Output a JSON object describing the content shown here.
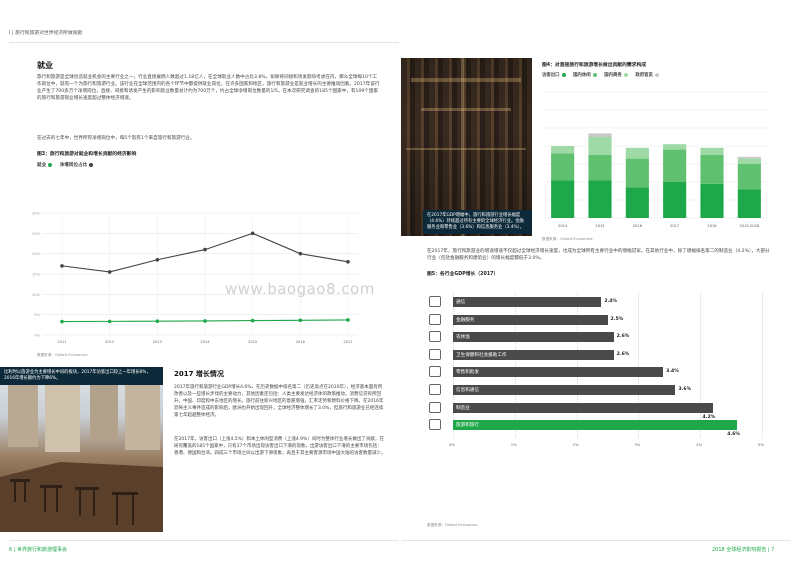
{
  "header": {
    "section_title": "I | 旅行和旅游对世界经济所做贡献"
  },
  "employment": {
    "heading": "就业",
    "paragraph1": "旅行和旅游是全球创造就业机会的主要行业之一，行业直接雇佣人数超过1.18亿人，在全球就业人数中占比3.8%。如果将间接和诱发影响考虑在内，那么全球每10个工作岗位中，就有一个为旅行和旅游行业。该行业在全球范围内的各个环节中都提供就业岗位，在许多国家和地区，旅行和旅游业是就业增长的主要推动因素。2017年该行业产生了700多万个净增岗位，直接、间接和诱发产生的影响就业数量总计约为700万个，约占全球净增岗位数量的1/5。在本次研究调查的185个国家中，有109个国家的旅行和旅游就业增长速度超过整体经济增速。",
    "paragraph2": "在过去的七年中，世界所有净增岗位中，每5个就有1个来自旅行和旅游行业。"
  },
  "figure3": {
    "title": "图3：旅行和旅游对就业和增长贡献的经济影响",
    "legend": [
      {
        "label": "就业",
        "color": "#1fa84a"
      },
      {
        "label": "净增岗位占比",
        "color": "#444444"
      }
    ],
    "source": "数据来源：Oxford Economics"
  },
  "growth2017": {
    "heading": "2017 增长情况",
    "paragraph1": "2017年旅行和旅游行业GDP增长4.6%，在历史数据中排名第二（历史高点在2010年），经济基本面有所改善以及一些增长步伐的主要动力，其他因素还包括：人类主要发达经济体的政策推动，消费信贷有所回升，中国、印度和中东地区的增长，旅行前往新兴地区的意愿增强，汇率走势和燃料价格下降。在2016年恐怖主义事件造成的影响后，欧洲也开始出现回升，全球经济整体增长了3.0%，但旅行和旅游业已经连续第七年超越整体经济。",
    "paragraph2": "在2017年，访客出口（上涨4.5%）和本土休闲型消费（上涨4.9%）同时为整体行业增长做出了贡献，在研究覆盖的185个国家中，只有37个市场出现访客出口下滑的现象。出游访客出口下滑的主要市场包括：香港、德国和台湾。四成三个市场之间以出游下滑现象，再且于其主要客源市场中国大陆的访客数量减少。"
  },
  "photo_top_caption": "在2017年GDP增幅中，旅行和旅游行业增长幅度（4.6%）持续超过所有主要的全球经济行业。金融服务业和零售业（3.6%）和信息服务业（3.4%）。",
  "photo_bottom_caption": "比利时以旅游业为主要增长中间的板块，2017年访客出口较上一年增长8%，2016年增长额约为下降6%。",
  "figure4": {
    "title": "图4：对直接旅行和旅游增长做出贡献的需求构成",
    "legend": [
      {
        "label": "访客出口",
        "color": "#1fa84a"
      },
      {
        "label": "国内休闲",
        "color": "#5fc16f"
      },
      {
        "label": "国内商务",
        "color": "#9ed9a6"
      },
      {
        "label": "政府官员",
        "color": "#c9c9c9"
      }
    ],
    "source": "数据来源：Oxford Economics"
  },
  "middle_paragraph": "在2017年，旅行和旅游业的增速增速不仅超过全球经济增长速度，也成为全球所有主要行业中的增幅冠军。在其他行业中，除了增幅排名第二的制造业（4.2%），大部分行业（包括金融服务和建筑业）的增长幅度都低于3.0%。",
  "figure5": {
    "title": "图5：各行业GDP增长（2017）",
    "source": "数据来源：Oxford Economics",
    "ticks": [
      "0%",
      "1%",
      "2%",
      "3%",
      "4%",
      "5%"
    ]
  },
  "footer": {
    "left": "6 | 世界旅行和旅游理事会",
    "right": "2018 全球经济影响报告 | 7"
  },
  "watermark": "www.baogao8.com",
  "chart_data": [
    {
      "type": "line",
      "x": [
        "2011",
        "2012",
        "2013",
        "2014",
        "2015",
        "2016",
        "2017"
      ],
      "series": [
        {
          "name": "就业",
          "values": [
            3.3,
            3.35,
            3.4,
            3.45,
            3.55,
            3.6,
            3.7
          ]
        },
        {
          "name": "净增岗位占比",
          "values": [
            17.0,
            15.5,
            18.5,
            21.0,
            25.0,
            20.0,
            18.0
          ]
        }
      ],
      "yticks": [
        "0%",
        "5%",
        "10%",
        "15%",
        "20%",
        "25%",
        "30%"
      ],
      "ylim": [
        0,
        30
      ],
      "grid": true,
      "legend_position": "top-left"
    },
    {
      "type": "bar",
      "stacked": true,
      "categories": [
        "2014",
        "2015",
        "2016",
        "2017",
        "2018",
        "2019-2028"
      ],
      "series": [
        {
          "name": "访客出口",
          "values": [
            2.1,
            2.1,
            1.7,
            2.0,
            1.9,
            1.6
          ],
          "color": "#1fa84a"
        },
        {
          "name": "国内休闲",
          "values": [
            1.5,
            1.4,
            1.6,
            1.8,
            1.6,
            1.4
          ],
          "color": "#5fc16f"
        },
        {
          "name": "国内商务",
          "values": [
            0.4,
            1.0,
            0.6,
            0.3,
            0.4,
            0.3
          ],
          "color": "#9ed9a6"
        },
        {
          "name": "政府官员",
          "values": [
            0.0,
            0.2,
            0.0,
            0.0,
            0.0,
            0.1
          ],
          "color": "#c9c9c9"
        }
      ],
      "ylim": [
        0,
        7
      ],
      "grid": true,
      "legend_position": "top-left"
    },
    {
      "type": "bar",
      "orientation": "horizontal",
      "categories": [
        "通信",
        "金融服务",
        "农林渔",
        "卫生保健和社会援助工作",
        "零售和批发",
        "信息和通信",
        "制造业",
        "旅游和旅行"
      ],
      "values": [
        2.4,
        2.5,
        2.6,
        2.6,
        3.4,
        3.6,
        4.2,
        4.6
      ],
      "value_labels": [
        "2.4%",
        "2.5%",
        "2.6%",
        "2.6%",
        "3.4%",
        "3.6%",
        "4.2%",
        "4.6%"
      ],
      "highlight": "旅游和旅行",
      "xlim": [
        0,
        5
      ]
    }
  ]
}
